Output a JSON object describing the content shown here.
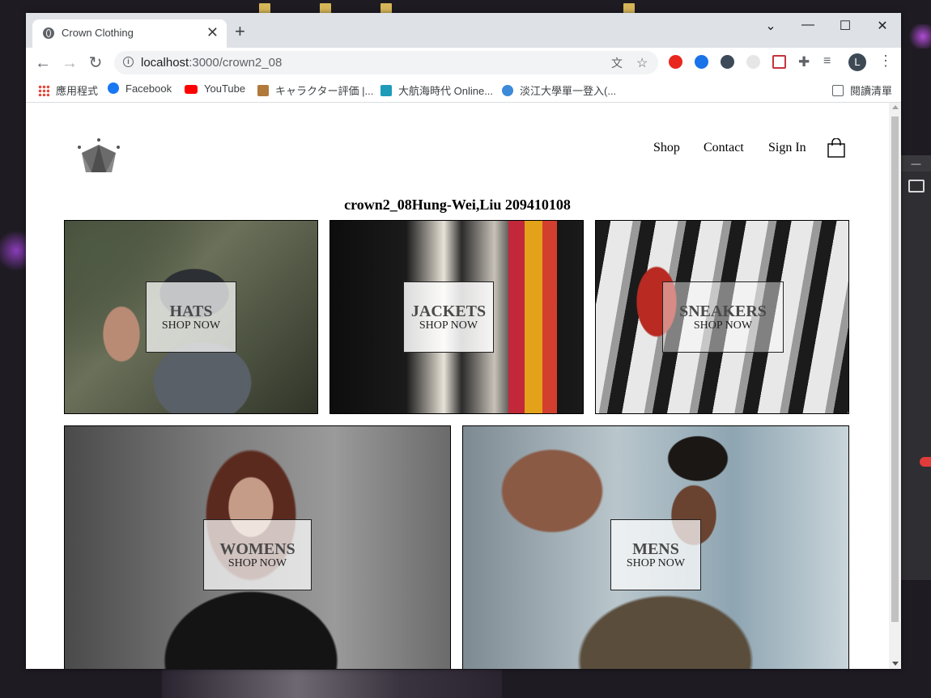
{
  "browser": {
    "tab_title": "Crown Clothing",
    "tab_close": "✕",
    "new_tab": "+",
    "url_host": "localhost",
    "url_path": ":3000/crown2_08",
    "avatar_letter": "L",
    "window_controls": [
      "⌄",
      "—",
      "☐",
      "✕"
    ]
  },
  "bookmarks": [
    {
      "label": "應用程式",
      "icon": "apps-grid-icon",
      "color": "#ea4335"
    },
    {
      "label": "Facebook",
      "icon": "facebook-icon",
      "color": "#1877f2"
    },
    {
      "label": "YouTube",
      "icon": "youtube-icon",
      "color": "#ff0000"
    },
    {
      "label": "キャラクター評価 |...",
      "icon": "character-icon",
      "color": "#b07a3c"
    },
    {
      "label": "大航海時代 Online...",
      "icon": "ship-icon",
      "color": "#1e9bb8"
    },
    {
      "label": "淡江大學單一登入(...",
      "icon": "people-icon",
      "color": "#3c8ad8"
    },
    {
      "label": "閱讀清單",
      "icon": "reading-list-icon",
      "color": "#5f6368"
    }
  ],
  "header": {
    "nav": [
      "Shop",
      "Contact",
      "Sign In"
    ]
  },
  "page_title": "crown2_08Hung-Wei,Liu 209410108",
  "directory": [
    {
      "title": "HATS",
      "subtitle": "SHOP NOW"
    },
    {
      "title": "JACKETS",
      "subtitle": "SHOP NOW"
    },
    {
      "title": "SNEAKERS",
      "subtitle": "SHOP NOW"
    },
    {
      "title": "WOMENS",
      "subtitle": "SHOP NOW"
    },
    {
      "title": "MENS",
      "subtitle": "SHOP NOW"
    }
  ],
  "colors": {
    "tabbar": "#dee1e6",
    "omnibox": "#f1f3f4",
    "text": "#000000"
  }
}
